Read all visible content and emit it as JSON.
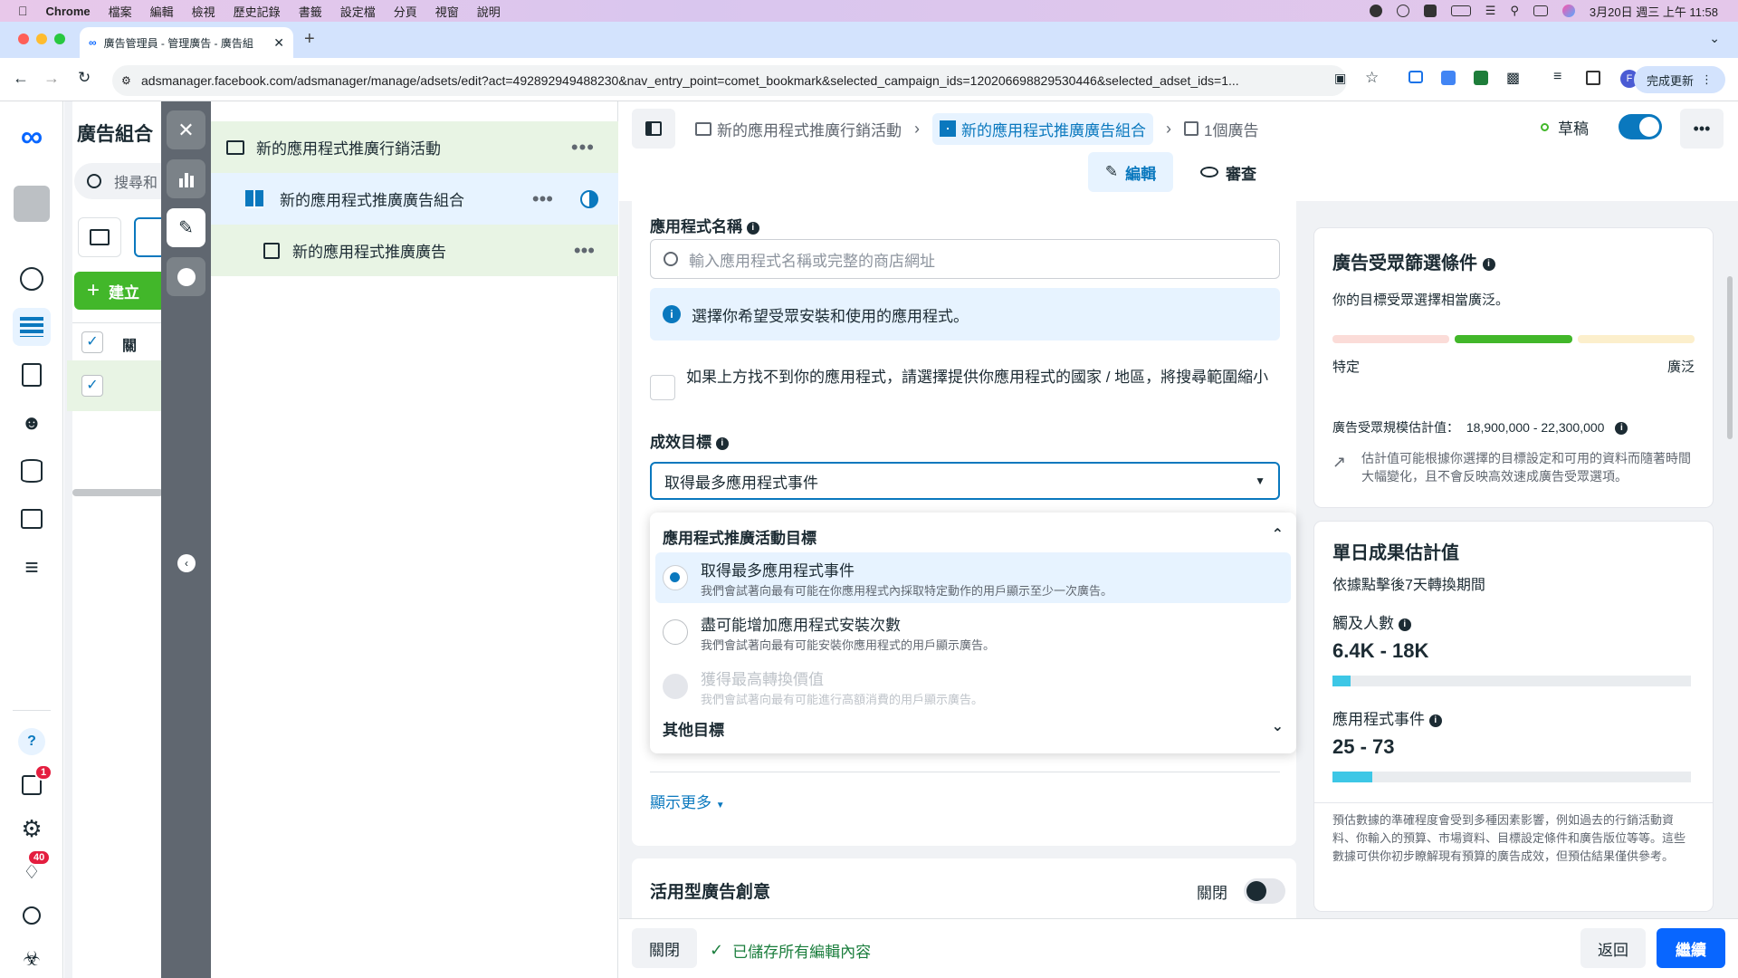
{
  "mac_menubar": {
    "app": "Chrome",
    "menus": [
      "檔案",
      "編輯",
      "檢視",
      "歷史記錄",
      "書籤",
      "設定檔",
      "分頁",
      "視窗",
      "說明"
    ],
    "clock": "3月20日 週三 上午 11:58"
  },
  "browser": {
    "tab_title": "廣告管理員 - 管理廣告 - 廣告組",
    "url": "adsmanager.facebook.com/adsmanager/manage/adsets/edit?act=492892949488230&nav_entry_point=comet_bookmark&selected_campaign_ids=120206698829530446&selected_adset_ids=1...",
    "update_button": "完成更新",
    "profile_initial": "F"
  },
  "rail": {
    "badges": {
      "notifications_small": "1",
      "alerts": "40"
    }
  },
  "subpanel": {
    "title": "廣告組合",
    "search_placeholder": "搜尋和",
    "create_button": "建立",
    "col_header": "關"
  },
  "tree": {
    "campaign": "新的應用程式推廣行銷活動",
    "adset": "新的應用程式推廣廣告組合",
    "ad": "新的應用程式推廣廣告"
  },
  "breadcrumb": {
    "campaign": "新的應用程式推廣行銷活動",
    "adset": "新的應用程式推廣廣告組合",
    "ads": "1個廣告"
  },
  "status": {
    "label": "草稿"
  },
  "mode_tabs": {
    "edit": "編輯",
    "review": "審查"
  },
  "form": {
    "app_name_label": "應用程式名稱",
    "app_name_placeholder": "輸入應用程式名稱或完整的商店網址",
    "app_info": "選擇你希望受眾安裝和使用的應用程式。",
    "checkbox_label": "如果上方找不到你的應用程式，請選擇提供你應用程式的國家 / 地區，將搜尋範圍縮小",
    "goal_label": "成效目標",
    "goal_selected": "取得最多應用程式事件",
    "dropdown_header": "應用程式推廣活動目標",
    "options": [
      {
        "title": "取得最多應用程式事件",
        "desc": "我們會試著向最有可能在你應用程式內採取特定動作的用戶顯示至少一次廣告。"
      },
      {
        "title": "盡可能增加應用程式安裝次數",
        "desc": "我們會試著向最有可能安裝你應用程式的用戶顯示廣告。"
      },
      {
        "title": "獲得最高轉換價值",
        "desc": "我們會試著向最有可能進行高額消費的用戶顯示廣告。"
      }
    ],
    "other_goals": "其他目標",
    "show_more": "顯示更多",
    "creative_title": "活用型廣告創意",
    "creative_toggle_label": "關閉"
  },
  "audience_card": {
    "title": "廣告受眾篩選條件",
    "desc": "你的目標受眾選擇相當廣泛。",
    "left_label": "特定",
    "right_label": "廣泛",
    "size_label": "廣告受眾規模估計值：",
    "size_value": "18,900,000 - 22,300,000",
    "note": "估計值可能根據你選擇的目標設定和可用的資料而隨著時間大幅變化，且不會反映高效速成廣告受眾選項。"
  },
  "results_card": {
    "title": "單日成果估計值",
    "subtitle": "依據點擊後7天轉換期間",
    "reach_label": "觸及人數",
    "reach_value": "6.4K - 18K",
    "reach_fill": 0.05,
    "events_label": "應用程式事件",
    "events_value": "25 - 73",
    "events_fill": 0.11,
    "disclaimer": "預估數據的準確程度會受到多種因素影響，例如過去的行銷活動資料、你輸入的預算、市場資料、目標設定條件和廣告版位等等。這些數據可供你初步瞭解現有預算的廣告成效，但預估結果僅供參考。"
  },
  "footer": {
    "close": "關閉",
    "saved": "已儲存所有編輯內容",
    "back": "返回",
    "continue": "繼續"
  },
  "colors": {
    "accent": "#0a78be",
    "green": "#42b72a",
    "primary_btn": "#0866ff"
  }
}
